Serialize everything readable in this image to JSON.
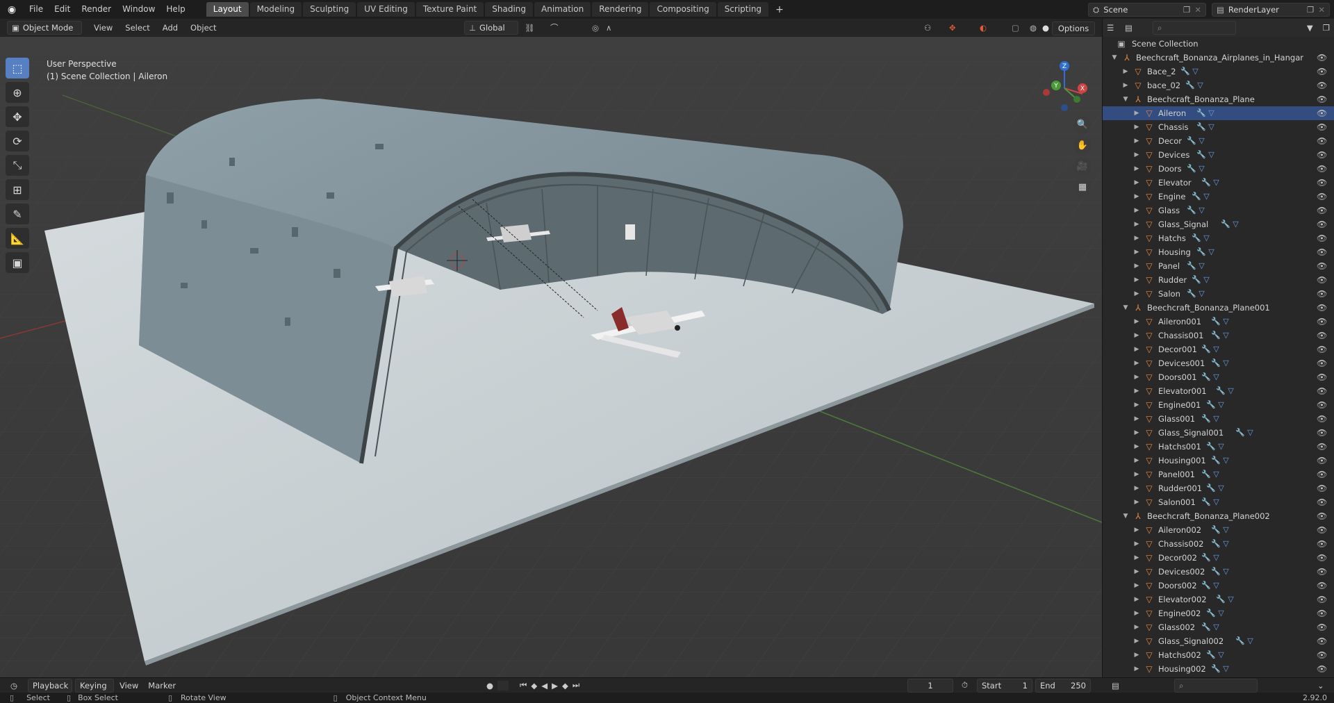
{
  "menu": {
    "file": "File",
    "edit": "Edit",
    "render": "Render",
    "window": "Window",
    "help": "Help"
  },
  "workspaces": [
    "Layout",
    "Modeling",
    "Sculpting",
    "UV Editing",
    "Texture Paint",
    "Shading",
    "Animation",
    "Rendering",
    "Compositing",
    "Scripting"
  ],
  "active_workspace": "Layout",
  "add_tab": "+",
  "scene": {
    "label": "Scene",
    "render_layer": "RenderLayer"
  },
  "viewport": {
    "mode": "Object Mode",
    "menus": [
      "View",
      "Select",
      "Add",
      "Object"
    ],
    "transform_orientation": "Global",
    "options": "Options",
    "overlay_title": "User Perspective",
    "overlay_sub": "(1) Scene Collection | Aileron",
    "gizmo": {
      "x": "X",
      "y": "Y",
      "z": "Z"
    }
  },
  "outliner": {
    "root": "Scene Collection",
    "rows": [
      {
        "label": "Beechcraft_Bonanza_Airplanes_in_Hangar",
        "level": 0,
        "expanded": true,
        "type": "empty"
      },
      {
        "label": "Bace_2",
        "level": 1,
        "expanded": false,
        "type": "mesh"
      },
      {
        "label": "bace_02",
        "level": 1,
        "expanded": false,
        "type": "mesh"
      },
      {
        "label": "Beechcraft_Bonanza_Plane",
        "level": 1,
        "expanded": true,
        "type": "empty"
      },
      {
        "label": "Aileron",
        "level": 2,
        "expanded": false,
        "type": "mesh",
        "active": true
      },
      {
        "label": "Chassis",
        "level": 2,
        "expanded": false,
        "type": "mesh"
      },
      {
        "label": "Decor",
        "level": 2,
        "expanded": false,
        "type": "mesh"
      },
      {
        "label": "Devices",
        "level": 2,
        "expanded": false,
        "type": "mesh"
      },
      {
        "label": "Doors",
        "level": 2,
        "expanded": false,
        "type": "mesh"
      },
      {
        "label": "Elevator",
        "level": 2,
        "expanded": false,
        "type": "mesh"
      },
      {
        "label": "Engine",
        "level": 2,
        "expanded": false,
        "type": "mesh"
      },
      {
        "label": "Glass",
        "level": 2,
        "expanded": false,
        "type": "mesh"
      },
      {
        "label": "Glass_Signal",
        "level": 2,
        "expanded": false,
        "type": "mesh"
      },
      {
        "label": "Hatchs",
        "level": 2,
        "expanded": false,
        "type": "mesh"
      },
      {
        "label": "Housing",
        "level": 2,
        "expanded": false,
        "type": "mesh"
      },
      {
        "label": "Panel",
        "level": 2,
        "expanded": false,
        "type": "mesh"
      },
      {
        "label": "Rudder",
        "level": 2,
        "expanded": false,
        "type": "mesh"
      },
      {
        "label": "Salon",
        "level": 2,
        "expanded": false,
        "type": "mesh"
      },
      {
        "label": "Beechcraft_Bonanza_Plane001",
        "level": 1,
        "expanded": true,
        "type": "empty"
      },
      {
        "label": "Aileron001",
        "level": 2,
        "expanded": false,
        "type": "mesh"
      },
      {
        "label": "Chassis001",
        "level": 2,
        "expanded": false,
        "type": "mesh"
      },
      {
        "label": "Decor001",
        "level": 2,
        "expanded": false,
        "type": "mesh"
      },
      {
        "label": "Devices001",
        "level": 2,
        "expanded": false,
        "type": "mesh"
      },
      {
        "label": "Doors001",
        "level": 2,
        "expanded": false,
        "type": "mesh"
      },
      {
        "label": "Elevator001",
        "level": 2,
        "expanded": false,
        "type": "mesh"
      },
      {
        "label": "Engine001",
        "level": 2,
        "expanded": false,
        "type": "mesh"
      },
      {
        "label": "Glass001",
        "level": 2,
        "expanded": false,
        "type": "mesh"
      },
      {
        "label": "Glass_Signal001",
        "level": 2,
        "expanded": false,
        "type": "mesh"
      },
      {
        "label": "Hatchs001",
        "level": 2,
        "expanded": false,
        "type": "mesh"
      },
      {
        "label": "Housing001",
        "level": 2,
        "expanded": false,
        "type": "mesh"
      },
      {
        "label": "Panel001",
        "level": 2,
        "expanded": false,
        "type": "mesh"
      },
      {
        "label": "Rudder001",
        "level": 2,
        "expanded": false,
        "type": "mesh"
      },
      {
        "label": "Salon001",
        "level": 2,
        "expanded": false,
        "type": "mesh"
      },
      {
        "label": "Beechcraft_Bonanza_Plane002",
        "level": 1,
        "expanded": true,
        "type": "empty"
      },
      {
        "label": "Aileron002",
        "level": 2,
        "expanded": false,
        "type": "mesh"
      },
      {
        "label": "Chassis002",
        "level": 2,
        "expanded": false,
        "type": "mesh"
      },
      {
        "label": "Decor002",
        "level": 2,
        "expanded": false,
        "type": "mesh"
      },
      {
        "label": "Devices002",
        "level": 2,
        "expanded": false,
        "type": "mesh"
      },
      {
        "label": "Doors002",
        "level": 2,
        "expanded": false,
        "type": "mesh"
      },
      {
        "label": "Elevator002",
        "level": 2,
        "expanded": false,
        "type": "mesh"
      },
      {
        "label": "Engine002",
        "level": 2,
        "expanded": false,
        "type": "mesh"
      },
      {
        "label": "Glass002",
        "level": 2,
        "expanded": false,
        "type": "mesh"
      },
      {
        "label": "Glass_Signal002",
        "level": 2,
        "expanded": false,
        "type": "mesh"
      },
      {
        "label": "Hatchs002",
        "level": 2,
        "expanded": false,
        "type": "mesh"
      },
      {
        "label": "Housing002",
        "level": 2,
        "expanded": false,
        "type": "mesh"
      }
    ]
  },
  "timeline": {
    "playback": "Playback",
    "keying": "Keying",
    "view": "View",
    "marker": "Marker",
    "current_frame": "1",
    "start_label": "Start",
    "start": "1",
    "end_label": "End",
    "end": "250"
  },
  "status": {
    "select": "Select",
    "box_select": "Box Select",
    "rotate_view": "Rotate View",
    "context_menu": "Object Context Menu",
    "version": "2.92.0"
  },
  "colors": {
    "accent": "#5680c2",
    "mesh_icon": "#e8883a",
    "modifier_icon": "#6a9ee8",
    "active_row": "#334d80"
  }
}
